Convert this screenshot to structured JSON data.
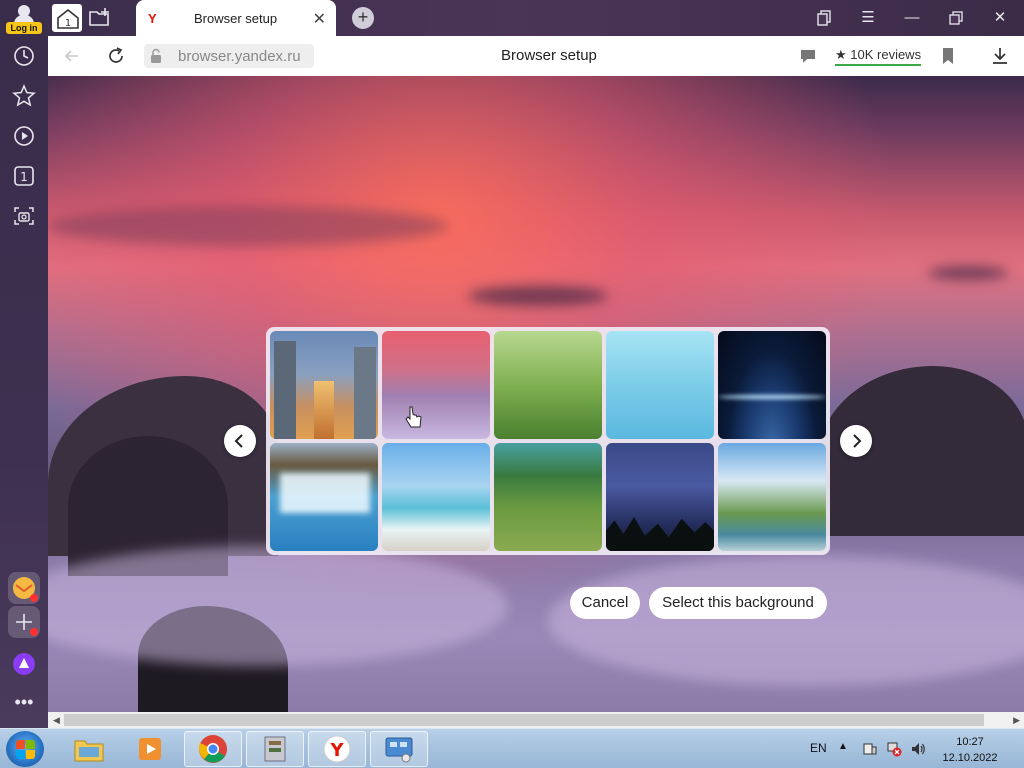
{
  "browser": {
    "login_label": "Log in",
    "tab_title": "Browser setup",
    "tab_favicon": "Y",
    "url": "browser.yandex.ru",
    "page_title": "Browser setup",
    "reviews": "★ 10K reviews",
    "home_tab_count": "1",
    "sidebar_counter": "1"
  },
  "gallery": {
    "items": [
      "city-street",
      "pink-sky-clouds",
      "green-grass",
      "blue-water",
      "earth-from-space",
      "waterfall",
      "beach-sea",
      "green-cliffs",
      "milky-way-forest",
      "lake-island-church"
    ]
  },
  "actions": {
    "cancel": "Cancel",
    "select": "Select this background"
  },
  "taskbar": {
    "lang": "EN",
    "time": "10:27",
    "date": "12.10.2022"
  },
  "colors": {
    "accent_red": "#e61400",
    "reviews_underline": "#3aa845",
    "alice_purple": "#8a3cf0"
  }
}
